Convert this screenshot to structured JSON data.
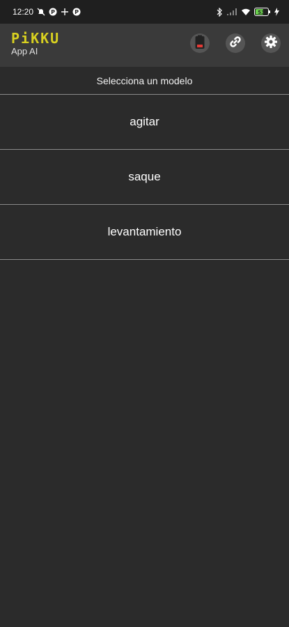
{
  "status_bar": {
    "time": "12:20",
    "battery_level": "53"
  },
  "app_bar": {
    "logo": "PiKKU",
    "subtitle": "App AI",
    "icons": [
      "battery-low-icon",
      "link-icon",
      "gear-icon"
    ]
  },
  "subheader": {
    "title": "Selecciona un modelo"
  },
  "models": [
    {
      "label": "agitar"
    },
    {
      "label": "saque"
    },
    {
      "label": "levantamiento"
    }
  ],
  "colors": {
    "brand": "#d8d020",
    "background": "#2b2b2b",
    "app_bar": "#3a3a3a",
    "divider": "#8a8a8a"
  }
}
